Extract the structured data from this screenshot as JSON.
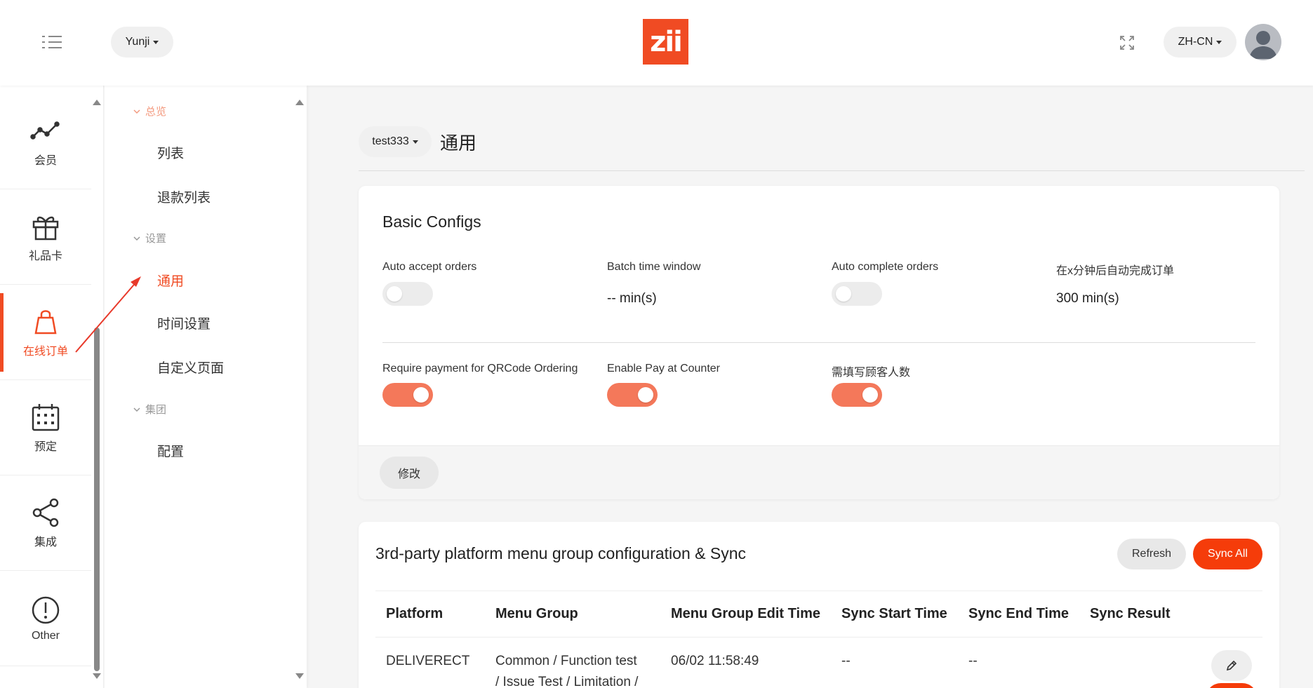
{
  "header": {
    "store_selector": "Yunji",
    "logo_text": "zii",
    "language_selector": "ZH-CN",
    "icons": [
      "menu-toggle-icon",
      "fullscreen-icon",
      "avatar-icon"
    ]
  },
  "sidebar": {
    "items": [
      {
        "label": "会员",
        "icon": "trend-line-icon"
      },
      {
        "label": "礼品卡",
        "icon": "gift-icon"
      },
      {
        "label": "在线订单",
        "icon": "shopping-bag-icon",
        "active": true
      },
      {
        "label": "预定",
        "icon": "calendar-icon"
      },
      {
        "label": "集成",
        "icon": "share-icon"
      },
      {
        "label": "Other",
        "icon": "exclamation-circle-icon"
      }
    ]
  },
  "submenu": {
    "groups": [
      {
        "title": "总览",
        "items": [
          "列表",
          "退款列表"
        ]
      },
      {
        "title": "设置",
        "items": [
          "通用",
          "时间设置",
          "自定义页面"
        ]
      },
      {
        "title": "集团",
        "items": [
          "配置"
        ]
      }
    ],
    "active_item": "通用"
  },
  "page": {
    "store_selector": "test333",
    "title": "通用"
  },
  "basic_configs": {
    "title": "Basic Configs",
    "fields": [
      {
        "label": "Auto accept orders",
        "type": "toggle",
        "on": false
      },
      {
        "label": "Batch time window",
        "type": "value",
        "value": "-- min(s)"
      },
      {
        "label": "Auto complete orders",
        "type": "toggle",
        "on": false
      },
      {
        "label": "在x分钟后自动完成订单",
        "type": "value",
        "value": "300 min(s)"
      },
      {
        "label": "Require payment for QRCode Ordering",
        "type": "toggle",
        "on": true
      },
      {
        "label": "Enable Pay at Counter",
        "type": "toggle",
        "on": true
      },
      {
        "label": "需填写顾客人数",
        "type": "toggle",
        "on": true
      }
    ],
    "edit_button": "修改"
  },
  "sync_section": {
    "title": "3rd-party platform menu group configuration & Sync",
    "refresh_button": "Refresh",
    "sync_all_button": "Sync All",
    "columns": [
      "Platform",
      "Menu Group",
      "Menu Group Edit Time",
      "Sync Start Time",
      "Sync End Time",
      "Sync Result"
    ],
    "rows": [
      {
        "platform": "DELIVERECT",
        "menu_group_line1": "Common / Function test",
        "menu_group_line2": "/ Issue Test / Limitation /",
        "edit_time": "06/02 11:58:49",
        "sync_start": "--",
        "sync_end": "--",
        "sync_result": ""
      }
    ]
  },
  "colors": {
    "accent": "#f04b23",
    "toggle_on": "#f4785a",
    "sync_all": "#f53c0a"
  }
}
